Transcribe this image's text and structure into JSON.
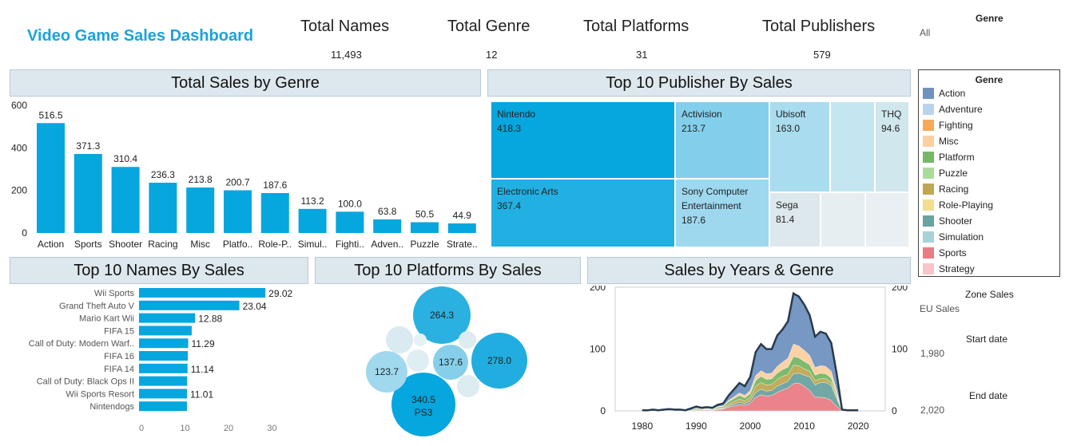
{
  "dashboard": {
    "title": "Video Game Sales Dashboard"
  },
  "kpis": [
    {
      "label": "Total Names",
      "value": "11,493"
    },
    {
      "label": "Total Genre",
      "value": "12"
    },
    {
      "label": "Total Platforms",
      "value": "31"
    },
    {
      "label": "Total Publishers",
      "value": "579"
    }
  ],
  "filters": {
    "genre": {
      "label": "Genre",
      "value": "All"
    }
  },
  "legend": {
    "title": "Genre",
    "items": [
      {
        "label": "Action",
        "color": "#6f93c0"
      },
      {
        "label": "Adventure",
        "color": "#b9d3ee"
      },
      {
        "label": "Fighting",
        "color": "#f6a95a"
      },
      {
        "label": "Misc",
        "color": "#fcd0a0"
      },
      {
        "label": "Platform",
        "color": "#76b866"
      },
      {
        "label": "Puzzle",
        "color": "#a9dc9a"
      },
      {
        "label": "Racing",
        "color": "#bfa752"
      },
      {
        "label": "Role-Playing",
        "color": "#f4de8e"
      },
      {
        "label": "Shooter",
        "color": "#6aa3a0"
      },
      {
        "label": "Simulation",
        "color": "#a7d2d8"
      },
      {
        "label": "Sports",
        "color": "#ea7d84"
      },
      {
        "label": "Strategy",
        "color": "#f8c4c7"
      }
    ]
  },
  "parameters": {
    "zone_sales": {
      "label": "Zone Sales",
      "value": "EU Sales"
    },
    "start_date": {
      "label": "Start date",
      "value": "1,980"
    },
    "end_date": {
      "label": "End date",
      "value": "2,020"
    }
  },
  "sections": {
    "genre": "Total Sales by Genre",
    "publisher": "Top 10 Publisher By Sales",
    "names": "Top 10 Names By Sales",
    "platforms": "Top 10 Platforms By Sales",
    "years": "Sales by Years & Genre"
  },
  "colors": {
    "accent": "#06a6df",
    "header": "#dde8ee",
    "title": "#1aa3dc"
  },
  "chart_data": [
    {
      "type": "bar",
      "title": "Total Sales by Genre",
      "categories": [
        "Action",
        "Sports",
        "Shooter",
        "Racing",
        "Misc",
        "Platfo..",
        "Role-P..",
        "Simul..",
        "Fighti..",
        "Adven..",
        "Puzzle",
        "Strate.."
      ],
      "values": [
        516.5,
        371.3,
        310.4,
        236.3,
        213.8,
        200.7,
        187.6,
        113.2,
        100.0,
        63.8,
        50.5,
        44.9
      ],
      "value_labels": [
        "516.5",
        "371.3",
        "310.4",
        "236.3",
        "213.8",
        "200.7",
        "187.6",
        "113.2",
        "100.0",
        "63.8",
        "50.5",
        "44.9"
      ],
      "yticks": [
        "0",
        "200",
        "400",
        "600"
      ],
      "ylim": [
        0,
        600
      ]
    },
    {
      "type": "treemap",
      "title": "Top 10 Publisher By Sales",
      "cells": [
        {
          "name": "Nintendo",
          "value": "418.3"
        },
        {
          "name": "Electronic Arts",
          "value": "367.4"
        },
        {
          "name": "Activision",
          "value": "213.7"
        },
        {
          "name": "Sony Computer Entertainment",
          "value": "187.6"
        },
        {
          "name": "Ubisoft",
          "value": "163.0"
        },
        {
          "name": "THQ",
          "value": "94.6"
        },
        {
          "name": "Sega",
          "value": "81.4"
        },
        {
          "name": "",
          "value": ""
        },
        {
          "name": "",
          "value": ""
        },
        {
          "name": "",
          "value": ""
        }
      ]
    },
    {
      "type": "bar",
      "orientation": "horizontal",
      "title": "Top 10 Names By Sales",
      "categories": [
        "Wii Sports",
        "Grand Theft Auto V",
        "Mario Kart Wii",
        "FIFA 15",
        "Call of Duty: Modern Warf..",
        "FIFA 16",
        "FIFA 14",
        "Call of Duty: Black Ops II",
        "Wii Sports Resort",
        "Nintendogs"
      ],
      "values": [
        29.02,
        23.04,
        12.88,
        12.1,
        11.29,
        11.2,
        11.14,
        11.05,
        11.01,
        11.0
      ],
      "value_labels": [
        "29.02",
        "23.04",
        "12.88",
        "",
        "11.29",
        "",
        "11.14",
        "",
        "11.01",
        ""
      ],
      "xticks": [
        "0",
        "10",
        "20",
        "30"
      ],
      "xlim": [
        0,
        38
      ]
    },
    {
      "type": "bubble",
      "title": "Top 10 Platforms By Sales",
      "bubbles": [
        {
          "label": "340.5",
          "sublabel": "PS3",
          "value": 340.5
        },
        {
          "label": "278.0",
          "value": 278.0
        },
        {
          "label": "264.3",
          "value": 264.3
        },
        {
          "label": "137.6",
          "value": 137.6
        },
        {
          "label": "123.7",
          "value": 123.7
        },
        {
          "label": "",
          "value": 60
        },
        {
          "label": "",
          "value": 55
        },
        {
          "label": "",
          "value": 50
        },
        {
          "label": "",
          "value": 45
        },
        {
          "label": "",
          "value": 35
        }
      ]
    },
    {
      "type": "area",
      "title": "Sales by Years & Genre",
      "x": [
        1980,
        1981,
        1982,
        1983,
        1984,
        1985,
        1986,
        1987,
        1988,
        1989,
        1990,
        1991,
        1992,
        1993,
        1994,
        1995,
        1996,
        1997,
        1998,
        1999,
        2000,
        2001,
        2002,
        2003,
        2004,
        2005,
        2006,
        2007,
        2008,
        2009,
        2010,
        2011,
        2012,
        2013,
        2014,
        2015,
        2016,
        2017,
        2018,
        2019,
        2020
      ],
      "total": [
        1,
        1,
        2,
        1,
        2,
        3,
        2,
        2,
        1,
        4,
        7,
        5,
        6,
        5,
        10,
        12,
        25,
        35,
        45,
        40,
        55,
        95,
        108,
        100,
        100,
        122,
        132,
        145,
        190,
        185,
        172,
        155,
        120,
        128,
        125,
        110,
        60,
        2,
        1,
        1,
        1
      ],
      "series": [
        {
          "name": "Sports",
          "values": [
            0,
            0,
            0,
            0,
            0,
            0,
            0,
            0,
            0,
            0,
            1,
            1,
            1,
            1,
            2,
            3,
            6,
            8,
            10,
            9,
            12,
            22,
            26,
            24,
            25,
            30,
            34,
            37,
            44,
            45,
            40,
            33,
            22,
            22,
            21,
            17,
            7,
            0,
            0,
            0,
            0
          ]
        },
        {
          "name": "Shooter",
          "values": [
            0,
            0,
            0,
            0,
            0,
            0,
            0,
            0,
            0,
            0,
            0,
            0,
            0,
            0,
            1,
            1,
            2,
            3,
            4,
            3,
            4,
            8,
            9,
            8,
            8,
            10,
            10,
            11,
            16,
            16,
            18,
            22,
            20,
            24,
            25,
            24,
            13,
            0,
            0,
            0,
            0
          ]
        },
        {
          "name": "Racing",
          "values": [
            0,
            0,
            0,
            0,
            0,
            0,
            0,
            0,
            0,
            0,
            1,
            0,
            1,
            0,
            1,
            1,
            3,
            4,
            5,
            4,
            6,
            10,
            11,
            10,
            10,
            11,
            12,
            11,
            14,
            12,
            10,
            9,
            7,
            6,
            6,
            5,
            3,
            0,
            0,
            0,
            0
          ]
        },
        {
          "name": "Platform",
          "values": [
            0,
            0,
            0,
            0,
            0,
            1,
            0,
            0,
            0,
            1,
            2,
            1,
            1,
            1,
            2,
            2,
            4,
            5,
            6,
            5,
            6,
            9,
            10,
            9,
            9,
            10,
            11,
            12,
            14,
            13,
            12,
            11,
            9,
            9,
            8,
            7,
            4,
            0,
            0,
            0,
            0
          ]
        },
        {
          "name": "Misc",
          "values": [
            0,
            0,
            0,
            0,
            0,
            0,
            0,
            0,
            0,
            0,
            1,
            1,
            1,
            1,
            1,
            1,
            2,
            3,
            4,
            4,
            5,
            8,
            9,
            9,
            9,
            11,
            12,
            14,
            20,
            19,
            18,
            15,
            12,
            12,
            12,
            11,
            6,
            0,
            0,
            0,
            0
          ]
        },
        {
          "name": "Action",
          "values": [
            1,
            1,
            2,
            1,
            2,
            2,
            2,
            2,
            1,
            3,
            2,
            2,
            2,
            2,
            3,
            4,
            8,
            12,
            16,
            15,
            22,
            38,
            43,
            40,
            39,
            50,
            53,
            60,
            82,
            80,
            74,
            65,
            50,
            55,
            53,
            46,
            27,
            2,
            1,
            1,
            1
          ]
        }
      ],
      "xticks": [
        "1980",
        "1990",
        "2000",
        "2010",
        "2020"
      ],
      "yticks": [
        "0",
        "100",
        "200"
      ],
      "ylim": [
        0,
        200
      ]
    }
  ]
}
